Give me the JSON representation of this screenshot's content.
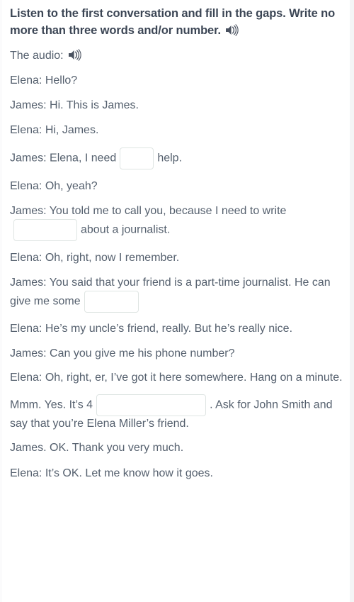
{
  "task": {
    "heading": "Listen to the first conversation and fill in the gaps. Write no more than three words and/or number.",
    "heading_audio_icon": "speaker-icon",
    "audio_label": "The audio:",
    "audio_icon": "speaker-icon"
  },
  "dialogue": [
    {
      "id": "l1",
      "text": "Elena: Hello?"
    },
    {
      "id": "l2",
      "text": "James: Hi. This is James."
    },
    {
      "id": "l3",
      "text": "Elena: Hi, James."
    },
    {
      "id": "l4",
      "before": "James: Elena, I need",
      "gap": {
        "value": "",
        "placeholder": "",
        "size": "w-xs"
      },
      "after": "help."
    },
    {
      "id": "l5",
      "text": "Elena: Oh, yeah?"
    },
    {
      "id": "l6",
      "before": "James: You told me to call you, because I need to write",
      "gap": {
        "value": "",
        "placeholder": "",
        "size": "w-sm"
      },
      "after": "about a journalist."
    },
    {
      "id": "l7",
      "text": "Elena: Oh, right, now I remember."
    },
    {
      "id": "l8",
      "before": "James: You said that your friend is a part-time journalist. He can give me some",
      "gap": {
        "value": "",
        "placeholder": "",
        "size": "w-md"
      },
      "after": ""
    },
    {
      "id": "l9",
      "text": "Elena: He’s my uncle’s friend, really. But he’s really nice."
    },
    {
      "id": "l10",
      "text": "James: Can you give me his phone number?"
    },
    {
      "id": "l11",
      "text": "Elena: Oh, right, er, I’ve got it here somewhere. Hang on a minute."
    },
    {
      "id": "l12",
      "before": "Mmm. Yes. It’s 4",
      "gap": {
        "value": "",
        "placeholder": "",
        "size": "w-lg"
      },
      "after": ". Ask for John Smith and say that you’re Elena Miller’s friend."
    },
    {
      "id": "l13",
      "text": "James. OK. Thank you very much."
    },
    {
      "id": "l14",
      "text": "Elena: It’s OK. Let me know how it goes."
    }
  ],
  "colors": {
    "heading_text": "#3c4655",
    "body_text": "#55606e",
    "input_border": "#dfe5e3",
    "background": "#ffffff"
  }
}
